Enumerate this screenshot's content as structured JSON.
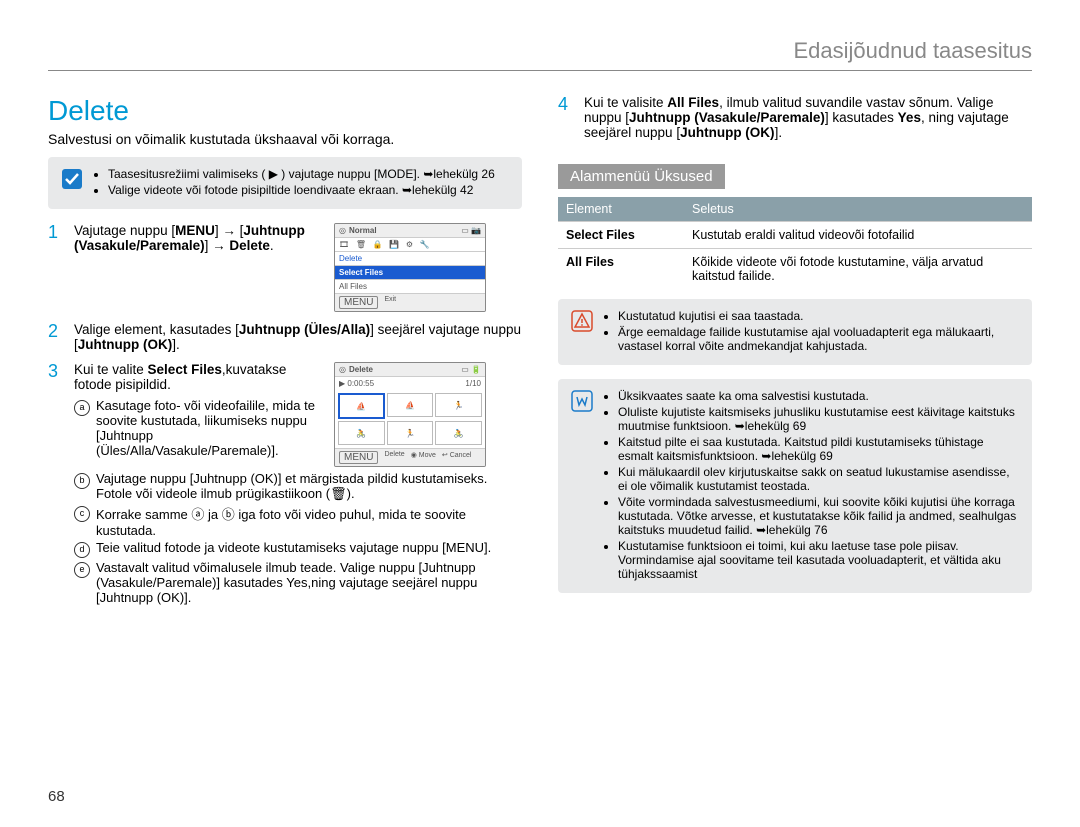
{
  "breadcrumb": "Edasijõudnud taasesitus",
  "title": "Delete",
  "lead": "Salvestusi on võimalik kustutada ükshaaval või korraga.",
  "note_a": {
    "items": [
      "Taasesitusrežiimi valimiseks ( ▶ ) vajutage nuppu [MODE]. ➥lehekülg 26",
      "Valige videote või fotode pisipiltide loendivaate ekraan. ➥lehekülg 42"
    ]
  },
  "steps": {
    "s1": {
      "num": "1",
      "text_a": "Vajutage nuppu [",
      "menu": "MENU",
      "text_b": "] → [",
      "ctrl": "Juhtnupp (Vasakule/Paremale)",
      "text_c": "] → ",
      "del": "Delete",
      "text_d": "."
    },
    "s2": {
      "num": "2",
      "text_a": "Valige element, kasutades [",
      "ctrl": "Juhtnupp (Üles/Alla)",
      "text_b": "] seejärel vajutage nuppu [",
      "ok": "Juhtnupp (OK)",
      "text_c": "]."
    },
    "s3": {
      "num": "3",
      "text_a": "Kui te valite ",
      "sel": "Select Files",
      "text_b": ",kuvatakse fotode pisipildid."
    },
    "s4": {
      "num": "4",
      "text_a": "Kui te valisite ",
      "all": "All Files",
      "text_b": ", ilmub valitud suvandile vastav sõnum. Valige nuppu [",
      "ctrl": "Juhtnupp (Vasakule/Paremale)",
      "text_c": "] kasutades ",
      "yes": "Yes",
      "text_d": ", ning vajutage seejärel nuppu [",
      "ok": "Juhtnupp (OK)",
      "text_e": "]."
    }
  },
  "mini1": {
    "header": "Normal",
    "rows": [
      "Delete",
      "Select Files",
      "All Files"
    ],
    "footer_menu": "MENU",
    "footer_exit": "Exit"
  },
  "mini2": {
    "header": "Delete",
    "time": "0:00:55",
    "count": "1/10",
    "footer_menu": "MENU",
    "footer_delete": "Delete",
    "footer_move": "Move",
    "footer_cancel": "Cancel"
  },
  "sublist": {
    "a": {
      "mk": "a",
      "text": "Kasutage foto- või videofailile, mida te soovite kustutada, liikumiseks nuppu [Juhtnupp (Üles/Alla/Vasakule/Paremale)]."
    },
    "b": {
      "mk": "b",
      "text": "Vajutage nuppu [Juhtnupp (OK)] et märgistada pildid kustutamiseks. Fotole või videole ilmub prügikastiikoon (🗑)."
    },
    "c": {
      "mk": "c",
      "text": "Korrake samme ⓐ ja ⓑ iga foto või video puhul, mida te soovite kustutada."
    },
    "d": {
      "mk": "d",
      "text": "Teie valitud fotode ja videote kustutamiseks vajutage nuppu [MENU]."
    },
    "e": {
      "mk": "e",
      "text": "Vastavalt valitud võimalusele ilmub teade. Valige nuppu [Juhtnupp (Vasakule/Paremale)] kasutades Yes,ning vajutage seejärel nuppu [Juhtnupp (OK)]."
    }
  },
  "submenu": {
    "heading": "Alammenüü Üksused",
    "th1": "Element",
    "th2": "Seletus",
    "r1": {
      "k": "Select Files",
      "v": "Kustutab eraldi valitud videovõi fotofailid"
    },
    "r2": {
      "k": "All Files",
      "v": "Kõikide videote või fotode kustutamine, välja arvatud kaitstud failide."
    }
  },
  "warn": {
    "items": [
      "Kustutatud kujutisi ei saa taastada.",
      "Ärge eemaldage failide kustutamise ajal vooluadapterit ega mälukaarti, vastasel korral võite andmekandjat kahjustada."
    ]
  },
  "info": {
    "items": [
      "Üksikvaates saate ka oma salvestisi kustutada.",
      "Oluliste kujutiste kaitsmiseks juhusliku kustutamise eest käivitage kaitstuks muutmise funktsioon. ➥lehekülg 69",
      "Kaitstud pilte ei saa kustutada. Kaitstud pildi kustutamiseks tühistage esmalt kaitsmisfunktsioon. ➥lehekülg 69",
      "Kui mälukaardil olev kirjutuskaitse sakk on seatud lukustamise asendisse, ei ole võimalik kustutamist teostada.",
      "Võite vormindada salvestusmeediumi, kui soovite kõiki kujutisi ühe korraga kustutada. Võtke arvesse, et kustutatakse kõik failid ja andmed, sealhulgas kaitstuks muudetud failid. ➥lehekülg 76",
      "Kustutamise funktsioon ei toimi, kui aku laetuse tase pole piisav. Vormindamise ajal soovitame teil kasutada vooluadapterit, et vältida aku tühjakssaamist"
    ]
  },
  "page_num": "68"
}
